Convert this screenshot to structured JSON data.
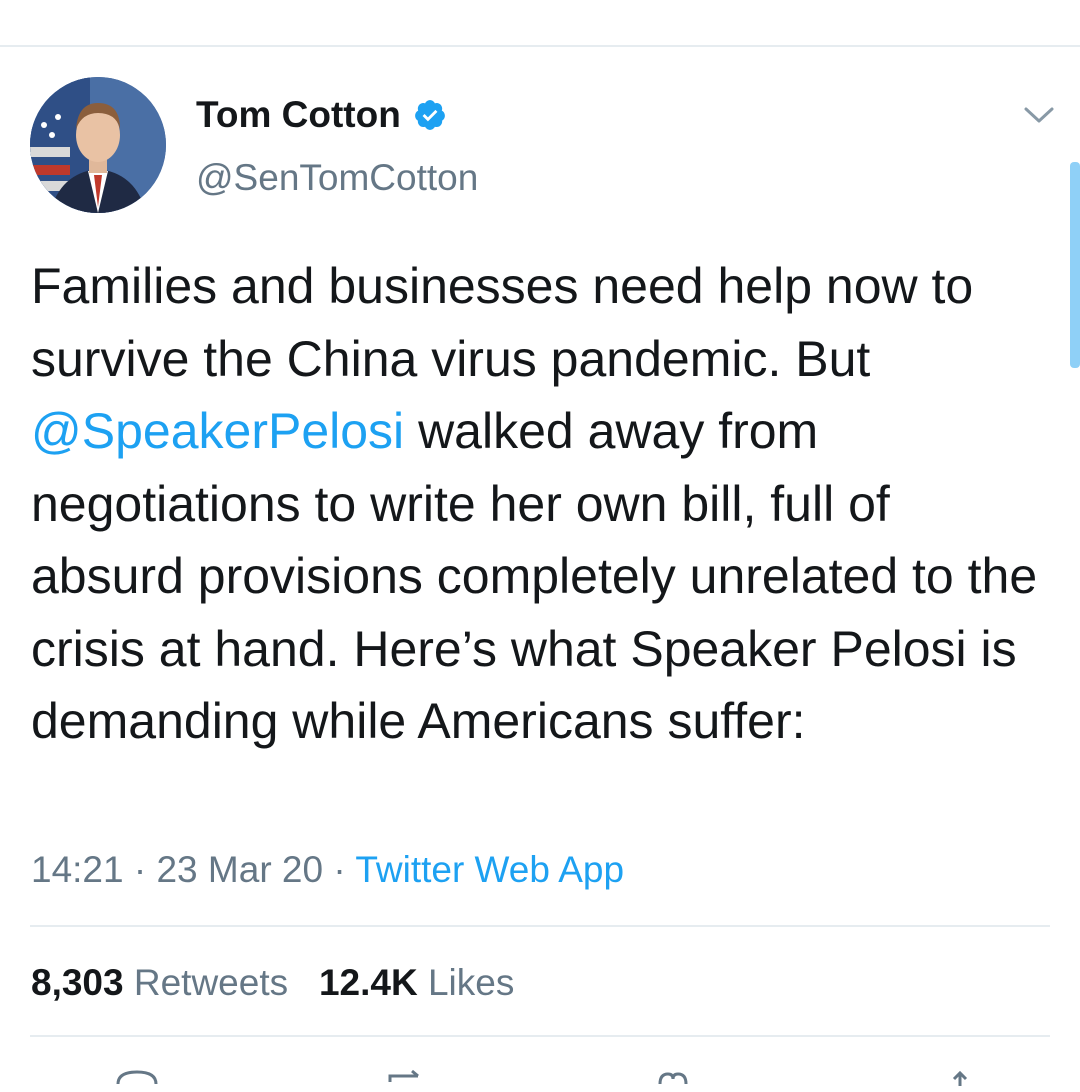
{
  "tweet": {
    "author": {
      "name": "Tom Cotton",
      "handle": "@SenTomCotton",
      "verified_icon": "verified-badge-icon"
    },
    "text": {
      "part1": "Families and businesses need help now to survive the China virus pandemic. But ",
      "mention": "@SpeakerPelosi",
      "part2": " walked away from negotiations to write her own bill, full of absurd provisions completely unrelated to the crisis at hand. Here’s what Speaker Pelosi is demanding while Americans suffer:"
    },
    "meta": {
      "time": "14:21",
      "separator": "·",
      "date": "23 Mar 20",
      "source": "Twitter Web App"
    },
    "stats": {
      "retweets_count": "8,303",
      "retweets_label": "Retweets",
      "likes_count": "12.4K",
      "likes_label": "Likes"
    }
  },
  "colors": {
    "accent": "#1da1f2",
    "secondary_text": "#657786",
    "primary_text": "#14171a",
    "divider": "#e6ecf0"
  }
}
